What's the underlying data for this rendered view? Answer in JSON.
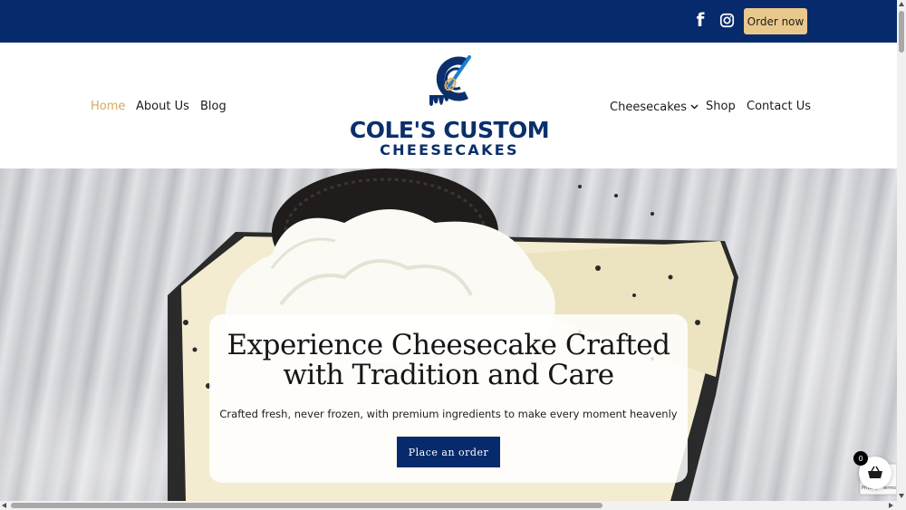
{
  "topbar": {
    "social_icons": [
      "facebook-icon",
      "instagram-icon"
    ],
    "order_label": "Order now"
  },
  "nav": {
    "left": [
      "Home",
      "About Us",
      "Blog"
    ],
    "right": [
      "Cheesecakes",
      "Shop",
      "Contact Us"
    ],
    "active": "Home"
  },
  "logo": {
    "title": "COLE'S CUSTOM",
    "subtitle": "CHEESECAKES"
  },
  "hero": {
    "title_line1": "Experience Cheesecake Crafted",
    "title_line2": "with Tradition and Care",
    "subtitle": "Crafted fresh, never frozen, with premium ingredients to make every moment heavenly",
    "cta": "Place an order"
  },
  "cart": {
    "count": "0",
    "icon": "basket-icon"
  },
  "recaptcha": {
    "text": "Privacy - Terms"
  },
  "colors": {
    "navy": "#062a6c",
    "gold": "#e9c98b",
    "active_nav": "#d9a85b"
  }
}
